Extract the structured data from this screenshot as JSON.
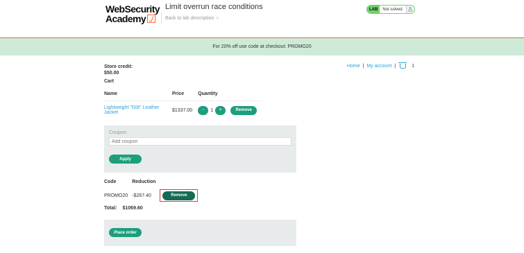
{
  "header": {
    "logo_line1": "WebSecurity",
    "logo_line2": "Academy",
    "lab_title": "Limit overrun race conditions",
    "back_link": "Back to lab description",
    "back_chevron": "»",
    "status_badge": "LAB",
    "status_text": "Not solved",
    "accent_color": "#ff6633",
    "status_color": "#70d16d"
  },
  "banner": {
    "text": "For 20% off use code at checkout: PROMO20"
  },
  "nav": {
    "home": "Home",
    "sep1": "|",
    "my_account": "My account",
    "sep2": "|",
    "cart_icon": "cart-icon",
    "cart_count": "1"
  },
  "store_credit": {
    "label": "Store credit:",
    "value": "$50.00"
  },
  "cart": {
    "heading": "Cart",
    "columns": [
      "Name",
      "Price",
      "Quantity"
    ],
    "items": [
      {
        "name": "Lightweight \"l33t\" Leather Jacket",
        "price": "$1337.00",
        "minus": "-",
        "quantity": "1",
        "plus": "+",
        "remove": "Remove"
      }
    ]
  },
  "coupon": {
    "label": "Coupon:",
    "placeholder": "Add coupon",
    "apply": "Apply"
  },
  "reductions": {
    "columns": [
      "Code",
      "Reduction"
    ],
    "rows": [
      {
        "code": "PROMO20",
        "reduction": "-$267.40",
        "remove": "Remove"
      }
    ]
  },
  "total": {
    "label": "Total:",
    "value": "$1069.60"
  },
  "order": {
    "place_order": "Place order"
  },
  "colors": {
    "button": "#1d9e7d",
    "link": "#29a1d6",
    "banner": "#ceead8",
    "panel": "#e7ebec",
    "highlight": "#e03a3a"
  }
}
